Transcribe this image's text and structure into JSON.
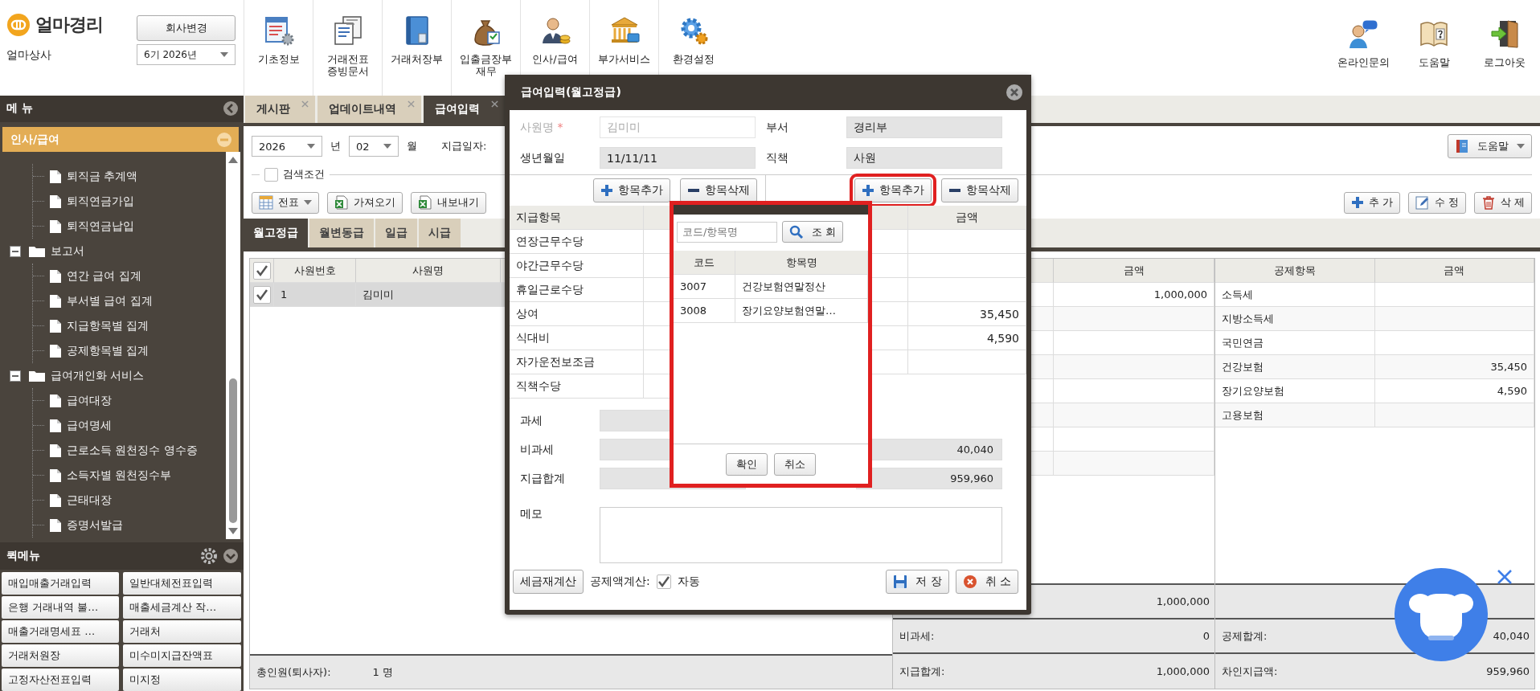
{
  "app": {
    "logo": "얼마경리",
    "company": "얼마상사",
    "change_company_button": "회사변경",
    "period": "6기 2026년"
  },
  "toolbar": [
    {
      "label": "기초정보",
      "kind": "form"
    },
    {
      "label": "거래전표\n증빙문서",
      "kind": "docs"
    },
    {
      "label": "거래처장부",
      "kind": "book"
    },
    {
      "label": "입출금장부\n재무",
      "kind": "bag"
    },
    {
      "label": "인사/급여",
      "kind": "person"
    },
    {
      "label": "부가서비스",
      "kind": "bank"
    },
    {
      "label": "환경설정",
      "kind": "gear"
    }
  ],
  "toolbar_right": [
    {
      "label": "온라인문의",
      "kind": "support"
    },
    {
      "label": "도움말",
      "kind": "help"
    },
    {
      "label": "로그아웃",
      "kind": "door"
    }
  ],
  "sidebar": {
    "title": "메 뉴",
    "section": "인사/급여",
    "tree": [
      {
        "kind": "folder",
        "children": [
          {
            "kind": "file",
            "label": "퇴직금 추계액"
          },
          {
            "kind": "file",
            "label": "퇴직연금가입"
          },
          {
            "kind": "file",
            "label": "퇴직연금납입"
          }
        ]
      },
      {
        "kind": "folder",
        "label": "보고서",
        "expanded": true,
        "children": [
          {
            "kind": "file",
            "label": "연간 급여 집계"
          },
          {
            "kind": "file",
            "label": "부서별 급여 집계"
          },
          {
            "kind": "file",
            "label": "지급항목별 집계"
          },
          {
            "kind": "file",
            "label": "공제항목별 집계"
          }
        ]
      },
      {
        "kind": "folder",
        "label": "급여개인화 서비스",
        "expanded": true,
        "children": [
          {
            "kind": "file",
            "label": "급여대장"
          },
          {
            "kind": "file",
            "label": "급여명세"
          },
          {
            "kind": "file",
            "label": "근로소득 원천징수 영수증"
          },
          {
            "kind": "file",
            "label": "소득자별 원천징수부"
          },
          {
            "kind": "file",
            "label": "근태대장"
          },
          {
            "kind": "file",
            "label": "증명서발급"
          }
        ]
      }
    ],
    "quick_menu_title": "퀵메뉴",
    "quick_menu": [
      "매입매출거래입력",
      "일반대체전표입력",
      "은행 거래내역 불…",
      "매출세금계산 작…",
      "매출거래명세표 …",
      "거래처",
      "거래처원장",
      "미수미지급잔액표",
      "고정자산전표입력",
      "미지정"
    ]
  },
  "tabs": [
    {
      "label": "게시판",
      "selected": false
    },
    {
      "label": "업데이트내역",
      "selected": false
    },
    {
      "label": "급여입력",
      "selected": true
    }
  ],
  "filters": {
    "year": "2026",
    "year_unit": "년",
    "month": "02",
    "month_unit": "월",
    "pay_date_label": "지급일자:"
  },
  "help_button": "도움말",
  "search_toggle": {
    "label": "검색조건",
    "checked": false
  },
  "actions_left": [
    {
      "label": "전표",
      "kind": "menu"
    },
    {
      "label": "가져오기",
      "kind": "sheet"
    },
    {
      "label": "내보내기",
      "kind": "sheet"
    }
  ],
  "actions_right": [
    {
      "label": "추 가",
      "kind": "add"
    },
    {
      "label": "수 정",
      "kind": "edit"
    },
    {
      "label": "삭 제",
      "kind": "delete"
    }
  ],
  "pay_tabs": [
    {
      "label": "월고정급",
      "selected": true
    },
    {
      "label": "월변동급",
      "selected": false
    },
    {
      "label": "일급",
      "selected": false
    },
    {
      "label": "시급",
      "selected": false
    }
  ],
  "employee_table": {
    "all_checked": true,
    "columns": [
      "사원번호",
      "사원명"
    ],
    "rows": [
      {
        "checked": true,
        "selected": true,
        "cells": [
          "1",
          "김미미"
        ]
      }
    ],
    "count_label": "총인원(퇴사자):",
    "count": "1 명"
  },
  "earnings": {
    "columns": [
      null,
      "금액"
    ],
    "rows": [
      [
        null,
        "1,000,000"
      ],
      [
        null,
        null
      ],
      [
        null,
        null
      ],
      [
        null,
        null
      ],
      [
        null,
        null
      ],
      [
        null,
        null
      ],
      [
        null,
        null
      ],
      [
        null,
        null
      ]
    ],
    "totals": [
      {
        "kind": "total",
        "value": "1,000,000"
      },
      {
        "kind": "total",
        "label": "비과세:",
        "value": "0"
      },
      {
        "kind": "total",
        "label": "지급합계:",
        "value": "1,000,000"
      }
    ]
  },
  "deductions": {
    "columns": [
      "공제항목",
      "금액"
    ],
    "rows": [
      [
        "소득세",
        null
      ],
      [
        "지방소득세",
        null
      ],
      [
        "국민연금",
        null
      ],
      [
        "건강보험",
        "35,450"
      ],
      [
        "장기요양보험",
        "4,590"
      ],
      [
        "고용보험",
        null
      ]
    ],
    "totals": [
      {
        "kind": "blank"
      },
      {
        "kind": "total",
        "label": "공제합계:",
        "value": "40,040"
      },
      {
        "kind": "total",
        "label": "차인지급액:",
        "value": "959,960"
      }
    ]
  },
  "dialog": {
    "title": "급여입력(월고정급)",
    "fields": [
      {
        "label": "사원명",
        "required_mark": "*",
        "disabled": true,
        "value": "김미미"
      },
      {
        "label": "부서",
        "disabled": false,
        "value": "경리부"
      },
      {
        "label": "생년월일",
        "disabled": false,
        "value": "11/11/11"
      },
      {
        "label": "직책",
        "disabled": false,
        "value": "사원"
      }
    ],
    "panels": [
      {
        "add_button": "항목추가",
        "delete_button": "항목삭제",
        "highlighted": false,
        "columns": [
          "지급항목",
          null
        ],
        "rows": [
          [
            "연장근무수당",
            null
          ],
          [
            "야간근무수당",
            null
          ],
          [
            "휴일근로수당",
            null
          ],
          [
            "상여",
            null
          ],
          [
            "식대비",
            null
          ],
          [
            "자가운전보조금",
            null
          ],
          [
            "직책수당",
            null
          ]
        ]
      },
      {
        "add_button": "항목추가",
        "delete_button": "항목삭제",
        "highlighted": true,
        "columns": [
          null,
          "금액"
        ],
        "rows": [
          [
            null,
            null
          ],
          [
            null,
            null
          ],
          [
            null,
            null
          ],
          [
            null,
            "35,450"
          ],
          [
            null,
            "4,590"
          ],
          [
            null,
            null
          ]
        ]
      }
    ],
    "summary": [
      {
        "label": "과세"
      },
      {
        "label": "비과세",
        "right_value": "40,040"
      },
      {
        "label": "지급합계",
        "right_value": "959,960"
      }
    ],
    "memo_label": "메모",
    "recalc_button": "세금재계산",
    "deduction_calc": {
      "label": "공제액계산:",
      "checked": true,
      "option": "자동"
    },
    "save_button": "저 장",
    "cancel_button": "취 소"
  },
  "item_picker": {
    "search_placeholder": "코드/항목명",
    "search_button": "조 회",
    "columns": [
      "코드",
      "항목명"
    ],
    "rows": [
      [
        "3007",
        "건강보험연말정산"
      ],
      [
        "3008",
        "장기요양보험연말…"
      ]
    ],
    "ok_button": "확인",
    "cancel_button": "취소"
  }
}
